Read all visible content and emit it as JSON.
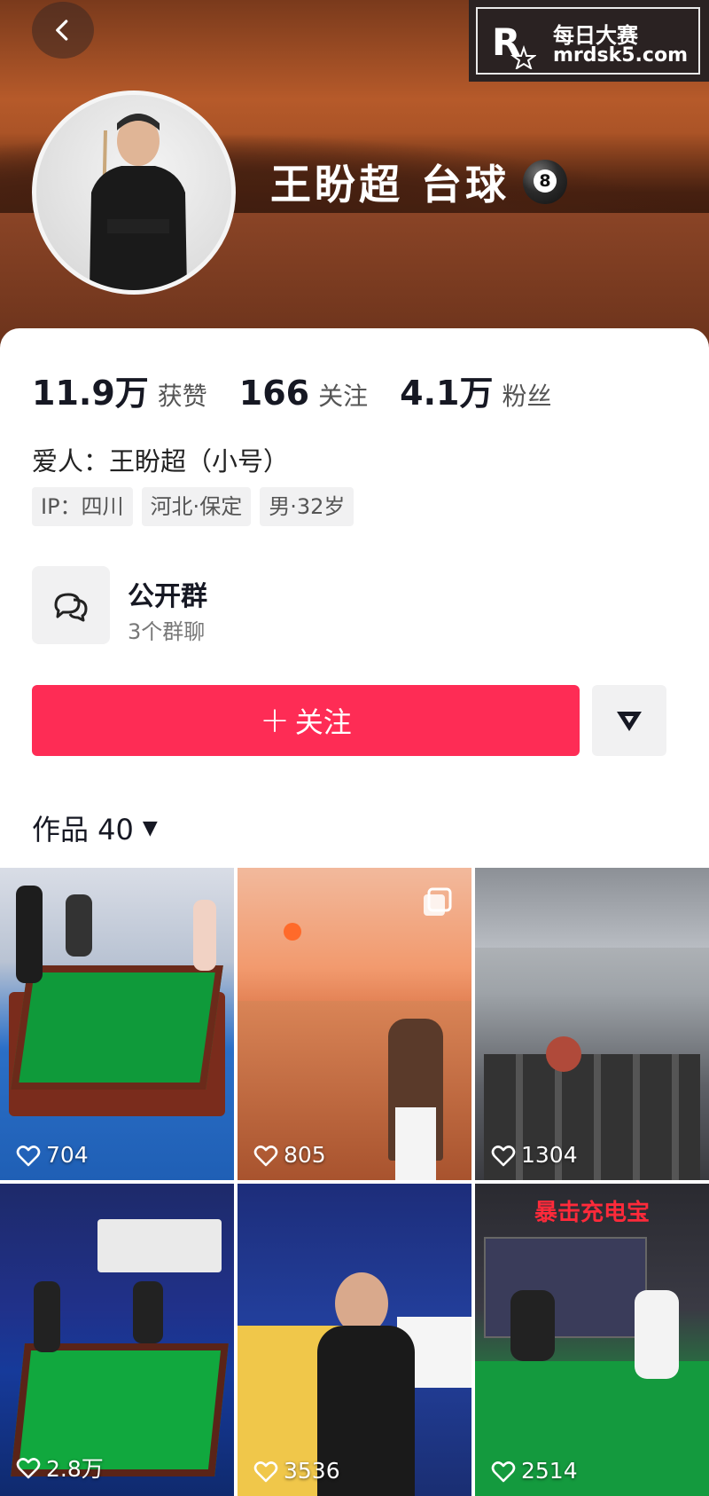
{
  "header": {
    "back_icon": "chevron-left-icon",
    "watermark": {
      "line1": "每日大赛",
      "line2": "mrdsk5.com"
    },
    "name": "王盼超 台球",
    "ball_number": "8"
  },
  "stats": [
    {
      "value": "11.9万",
      "label": "获赞"
    },
    {
      "value": "166",
      "label": "关注"
    },
    {
      "value": "4.1万",
      "label": "粉丝"
    }
  ],
  "bio": "爱人：王盼超（小号）",
  "tags": [
    "IP：四川",
    "河北·保定",
    "男·32岁"
  ],
  "group": {
    "title": "公开群",
    "subtitle": "3个群聊",
    "icon": "chat-bubbles-icon"
  },
  "actions": {
    "follow_label": "关注",
    "follow_color": "#fe2c55",
    "more_icon": "triangle-down-icon"
  },
  "works": {
    "label": "作品 40"
  },
  "videos": [
    {
      "likes": "704",
      "theme": "pool-table"
    },
    {
      "likes": "805",
      "theme": "sunset"
    },
    {
      "likes": "1304",
      "theme": "airplane"
    },
    {
      "likes": "2.8万",
      "theme": "tournament"
    },
    {
      "likes": "3536",
      "theme": "player"
    },
    {
      "likes": "2514",
      "theme": "pool-room",
      "caption": "暴击充电宝"
    }
  ]
}
